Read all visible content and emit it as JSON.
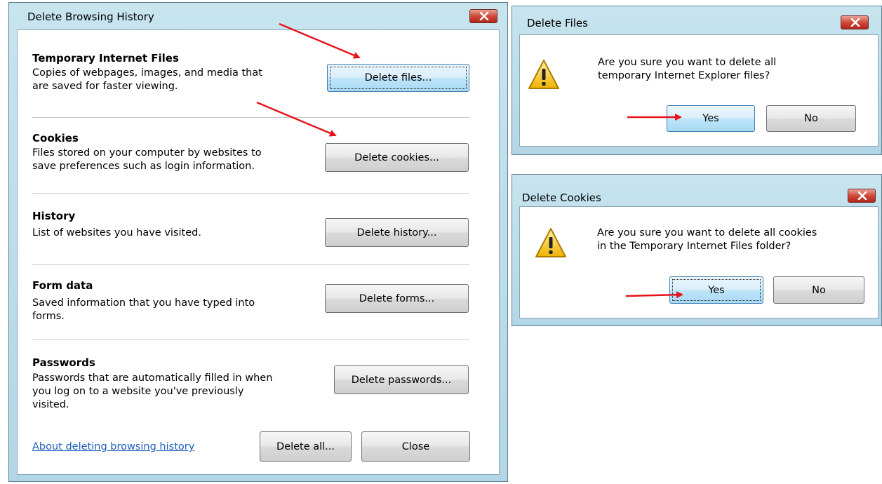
{
  "main_dialog": {
    "title": "Delete Browsing History",
    "sections": [
      {
        "title": "Temporary Internet Files",
        "desc1": "Copies of webpages, images, and media that",
        "desc2": "are saved for faster viewing.",
        "desc3": "",
        "button": "Delete files..."
      },
      {
        "title": "Cookies",
        "desc1": "Files stored on your computer by websites to",
        "desc2": "save preferences such as login information.",
        "desc3": "",
        "button": "Delete cookies..."
      },
      {
        "title": "History",
        "desc1": "List of websites you have visited.",
        "desc2": "",
        "desc3": "",
        "button": "Delete history..."
      },
      {
        "title": "Form data",
        "desc1": "Saved information that you have typed into",
        "desc2": "forms.",
        "desc3": "",
        "button": "Delete forms..."
      },
      {
        "title": "Passwords",
        "desc1": "Passwords that are automatically filled in when",
        "desc2": "you log on to a website you've previously",
        "desc3": "visited.",
        "button": "Delete passwords..."
      }
    ],
    "about_link": "About deleting browsing history",
    "delete_all_label": "Delete all...",
    "close_label": "Close"
  },
  "delete_files_dialog": {
    "title": "Delete Files",
    "message1": "Are you sure you want to delete all",
    "message2": "temporary Internet Explorer files?",
    "yes_label": "Yes",
    "no_label": "No"
  },
  "delete_cookies_dialog": {
    "title": "Delete Cookies",
    "message1": "Are you sure you want to delete all cookies",
    "message2": "in the Temporary Internet Files folder?",
    "yes_label": "Yes",
    "no_label": "No"
  },
  "icons": {
    "close": "close-x-icon",
    "warning": "warning-triangle-icon",
    "annotation": "red-arrow-annotation"
  },
  "colors": {
    "frame": "#b3d6e6",
    "close_button": "#cf4a3a",
    "link": "#1d5dbb",
    "arrow": "#e8121b"
  }
}
